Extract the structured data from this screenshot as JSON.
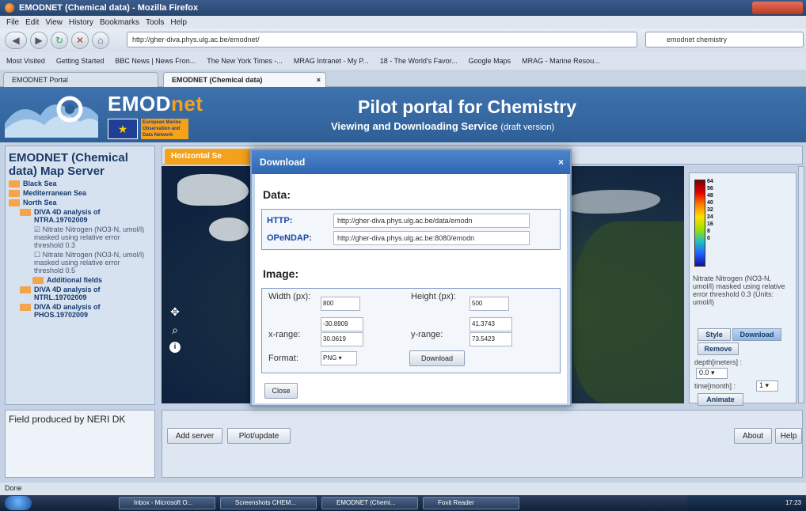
{
  "window": {
    "title": "EMODNET (Chemical data) - Mozilla Firefox"
  },
  "menu": [
    "File",
    "Edit",
    "View",
    "History",
    "Bookmarks",
    "Tools",
    "Help"
  ],
  "nav": {
    "url": "http://gher-diva.phys.ulg.ac.be/emodnet/",
    "search": "emodnet chemistry"
  },
  "bookmarks": [
    "Most Visited",
    "Getting Started",
    "BBC News | News Fron...",
    "The New York Times -...",
    "MRAG Intranet - My P...",
    "18 - The World's Favor...",
    "Google Maps",
    "MRAG - Marine Resou..."
  ],
  "tabs": [
    {
      "label": "EMODNET Portal"
    },
    {
      "label": "EMODNET (Chemical data)"
    }
  ],
  "header": {
    "brand_main": "EMOD",
    "brand_accent": "net",
    "eu_text": "European Marine Observation and Data Network",
    "title": "Pilot portal for Chemistry",
    "subtitle": "Viewing and Downloading Service",
    "draft": "(draft version)"
  },
  "left": {
    "title": "EMODNET (Chemical data) Map Server",
    "tree": {
      "black_sea": "Black Sea",
      "med_sea": "Mediterranean Sea",
      "north_sea": "North Sea",
      "diva1": "DIVA 4D analysis of NTRA.19702009",
      "layer1": "Nitrate Nitrogen (NO3-N, umol/l) masked using relative error threshold 0.3",
      "layer2": "Nitrate Nitrogen (NO3-N, umol/l) masked using relative error threshold 0.5",
      "additional": "Additional fields",
      "diva2": "DIVA 4D analysis of NTRL.19702009",
      "diva3": "DIVA 4D analysis of PHOS.19702009"
    },
    "lower_text": "Field produced by NERI DK"
  },
  "maptab": {
    "label": "Horizontal Se"
  },
  "legend": {
    "ticks": [
      "64",
      "56",
      "48",
      "40",
      "32",
      "24",
      "16",
      "8",
      "0"
    ],
    "text": "Nitrate Nitrogen (NO3-N, umol/l) masked using relative error threshold 0.3 (Units: umol/l)",
    "style": "Style",
    "download": "Download",
    "remove": "Remove",
    "depth_label": "depth[meters] :",
    "depth_value": "0.0",
    "time_label": "time[month] :",
    "time_value": "1",
    "animate": "Animate"
  },
  "bottom": {
    "add_server": "Add server",
    "plot_update": "Plot/update",
    "about": "About",
    "help": "Help"
  },
  "dialog": {
    "title": "Download",
    "close_x": "×",
    "data_heading": "Data:",
    "http_label": "HTTP:",
    "http_url": "http://gher-diva.phys.ulg.ac.be/data/emodn",
    "opendap_label": "OPeNDAP:",
    "opendap_url": "http://gher-diva.phys.ulg.ac.be:8080/emodn",
    "image_heading": "Image:",
    "width_label": "Width (px):",
    "width_value": "800",
    "height_label": "Height (px):",
    "height_value": "500",
    "xrange_label": "x-range:",
    "xmin": "-30.8909",
    "xmax": "30.0619",
    "yrange_label": "y-range:",
    "ymin": "41.3743",
    "ymax": "73.5423",
    "format_label": "Format:",
    "format_value": "PNG",
    "download_btn": "Download",
    "close_btn": "Close"
  },
  "status": "Done",
  "taskbar": [
    "Inbox - Microsoft O...",
    "Screenshots CHEM...",
    "EMODNET (Chemi...",
    "Foxit Reader"
  ],
  "tray_time": "17:23"
}
